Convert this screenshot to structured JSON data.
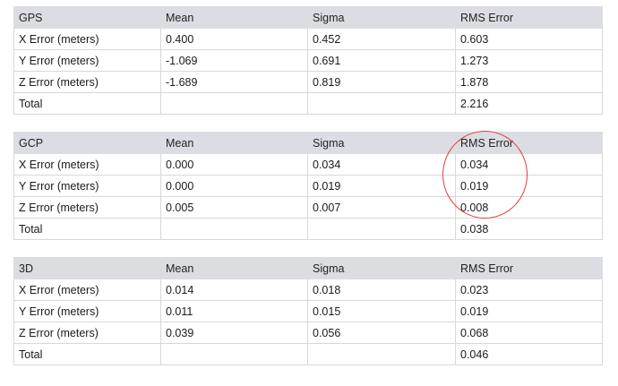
{
  "tables": [
    {
      "headers": [
        "GPS",
        "Mean",
        "Sigma",
        "RMS Error"
      ],
      "rows": [
        [
          "X Error (meters)",
          "0.400",
          "0.452",
          "0.603"
        ],
        [
          "Y Error (meters)",
          "-1.069",
          "0.691",
          "1.273"
        ],
        [
          "Z Error (meters)",
          "-1.689",
          "0.819",
          "1.878"
        ],
        [
          "Total",
          "",
          "",
          "2.216"
        ]
      ]
    },
    {
      "headers": [
        "GCP",
        "Mean",
        "Sigma",
        "RMS Error"
      ],
      "rows": [
        [
          "X Error (meters)",
          "0.000",
          "0.034",
          "0.034"
        ],
        [
          "Y Error (meters)",
          "0.000",
          "0.019",
          "0.019"
        ],
        [
          "Z Error (meters)",
          "0.005",
          "0.007",
          "0.008"
        ],
        [
          "Total",
          "",
          "",
          "0.038"
        ]
      ]
    },
    {
      "headers": [
        "3D",
        "Mean",
        "Sigma",
        "RMS Error"
      ],
      "rows": [
        [
          "X Error (meters)",
          "0.014",
          "0.018",
          "0.023"
        ],
        [
          "Y Error (meters)",
          "0.011",
          "0.015",
          "0.019"
        ],
        [
          "Z Error (meters)",
          "0.039",
          "0.056",
          "0.068"
        ],
        [
          "Total",
          "",
          "",
          "0.046"
        ]
      ]
    }
  ],
  "annotation": {
    "shape": "ellipse",
    "color": "#e23b3b",
    "target": "GCP RMS Error column"
  }
}
